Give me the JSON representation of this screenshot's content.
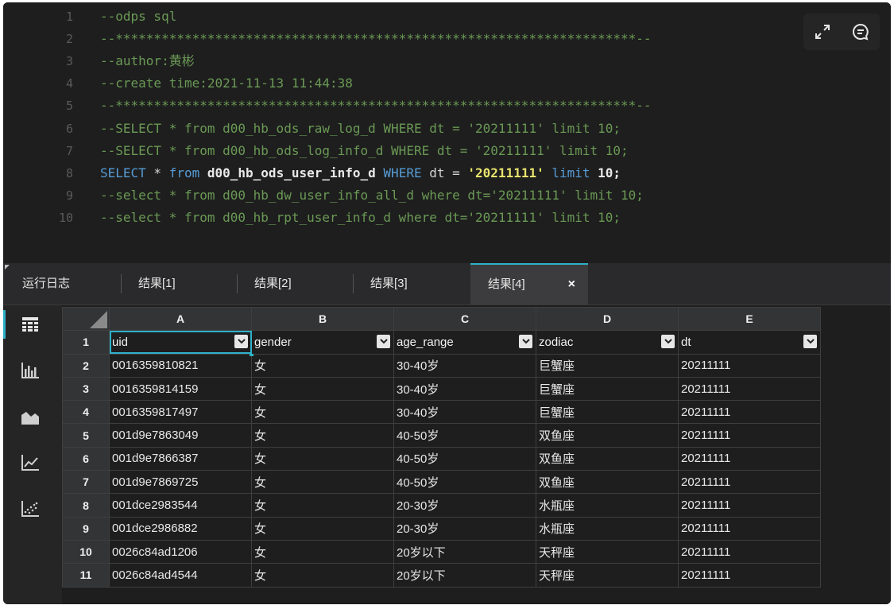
{
  "editor": {
    "lines": [
      {
        "num": "1",
        "text": "--odps sql",
        "type": "comment"
      },
      {
        "num": "2",
        "text": "--********************************************************************--",
        "type": "comment"
      },
      {
        "num": "3",
        "text": "--author:黄彬",
        "type": "comment"
      },
      {
        "num": "4",
        "text": "--create time:2021-11-13 11:44:38",
        "type": "comment"
      },
      {
        "num": "5",
        "text": "--********************************************************************--",
        "type": "comment"
      },
      {
        "num": "6",
        "text": "--SELECT * from d00_hb_ods_raw_log_d WHERE dt = '20211111' limit 10;",
        "type": "comment"
      },
      {
        "num": "7",
        "text": "--SELECT * from d00_hb_ods_log_info_d WHERE dt = '20211111' limit 10;",
        "type": "comment"
      },
      {
        "num": "8",
        "type": "code",
        "tokens": {
          "select": "SELECT",
          "star": " * ",
          "from": "from",
          "table": " d00_hb_ods_user_info_d ",
          "where": "WHERE",
          "cond": " dt = ",
          "value": "'20211111'",
          "space": " ",
          "limit": "limit",
          "tail": " 10;"
        }
      },
      {
        "num": "9",
        "text": "--select * from d00_hb_dw_user_info_all_d where dt='20211111' limit 10;",
        "type": "comment"
      },
      {
        "num": "10",
        "text": "--select * from d00_hb_rpt_user_info_d where dt='20211111' limit 10;",
        "type": "comment"
      }
    ],
    "buttons": {
      "expand_icon": "expand-icon",
      "comment_icon": "comment-icon"
    }
  },
  "tabs": {
    "log": "运行日志",
    "result1": "结果[1]",
    "result2": "结果[2]",
    "result3": "结果[3]",
    "result4": "结果[4]",
    "close": "×"
  },
  "sidebar": {
    "items": [
      "table-icon",
      "bar-chart-icon",
      "area-chart-icon",
      "line-chart-icon",
      "scatter-chart-icon"
    ]
  },
  "grid": {
    "columns": [
      "A",
      "B",
      "C",
      "D",
      "E"
    ],
    "header_row": {
      "num": "1",
      "cells": [
        "uid",
        "gender",
        "age_range",
        "zodiac",
        "dt"
      ]
    },
    "rows": [
      {
        "num": "2",
        "cells": [
          "0016359810821",
          "女",
          "30-40岁",
          "巨蟹座",
          "20211111"
        ]
      },
      {
        "num": "3",
        "cells": [
          "0016359814159",
          "女",
          "30-40岁",
          "巨蟹座",
          "20211111"
        ]
      },
      {
        "num": "4",
        "cells": [
          "0016359817497",
          "女",
          "30-40岁",
          "巨蟹座",
          "20211111"
        ]
      },
      {
        "num": "5",
        "cells": [
          "001d9e7863049",
          "女",
          "40-50岁",
          "双鱼座",
          "20211111"
        ]
      },
      {
        "num": "6",
        "cells": [
          "001d9e7866387",
          "女",
          "40-50岁",
          "双鱼座",
          "20211111"
        ]
      },
      {
        "num": "7",
        "cells": [
          "001d9e7869725",
          "女",
          "40-50岁",
          "双鱼座",
          "20211111"
        ]
      },
      {
        "num": "8",
        "cells": [
          "001dce2983544",
          "女",
          "20-30岁",
          "水瓶座",
          "20211111"
        ]
      },
      {
        "num": "9",
        "cells": [
          "001dce2986882",
          "女",
          "20-30岁",
          "水瓶座",
          "20211111"
        ]
      },
      {
        "num": "10",
        "cells": [
          "0026c84ad1206",
          "女",
          "20岁以下",
          "天秤座",
          "20211111"
        ]
      },
      {
        "num": "11",
        "cells": [
          "0026c84ad4544",
          "女",
          "20岁以下",
          "天秤座",
          "20211111"
        ]
      }
    ]
  },
  "colors": {
    "accent": "#2fb1c9",
    "comment": "#6a9955",
    "keyword": "#569cd6",
    "string": "#e9e46c"
  }
}
